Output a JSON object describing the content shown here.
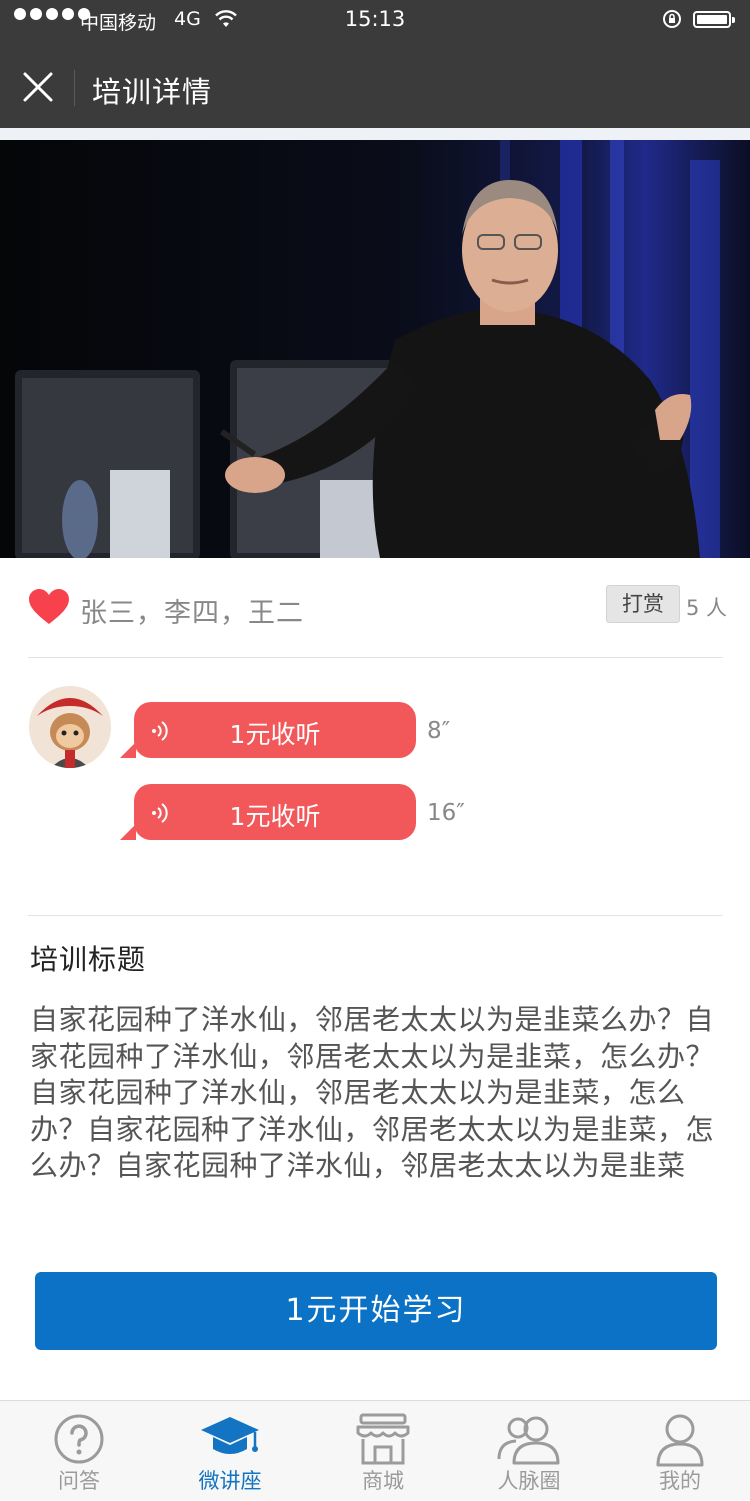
{
  "status_bar": {
    "carrier": "中国移动",
    "network": "4G",
    "time": "15:13"
  },
  "nav": {
    "title": "培训详情"
  },
  "likes": {
    "names": "张三，李四，王二",
    "reward_label": "打赏",
    "reward_count": "5 人"
  },
  "audio": [
    {
      "label": "1元收听",
      "duration": "8″"
    },
    {
      "label": "1元收听",
      "duration": "16″"
    }
  ],
  "course": {
    "title": "培训标题",
    "description": "自家花园种了洋水仙，邻居老太太以为是韭菜么办？自家花园种了洋水仙，邻居老太太以为是韭菜，怎么办？自家花园种了洋水仙，邻居老太太以为是韭菜，怎么办？自家花园种了洋水仙，邻居老太太以为是韭菜，怎么办？自家花园种了洋水仙，邻居老太太以为是韭菜"
  },
  "cta_label": "1元开始学习",
  "tabs": [
    {
      "label": "问答",
      "icon": "question-icon"
    },
    {
      "label": "微讲座",
      "icon": "graduation-cap-icon",
      "active": true
    },
    {
      "label": "商城",
      "icon": "store-icon"
    },
    {
      "label": "人脉圈",
      "icon": "contacts-icon"
    },
    {
      "label": "我的",
      "icon": "user-icon"
    }
  ],
  "colors": {
    "header_bg": "#3b3b3b",
    "bubble": "#f2575a",
    "primary": "#0b72c5",
    "heart": "#f7424d",
    "tab_active": "#1274c2"
  }
}
